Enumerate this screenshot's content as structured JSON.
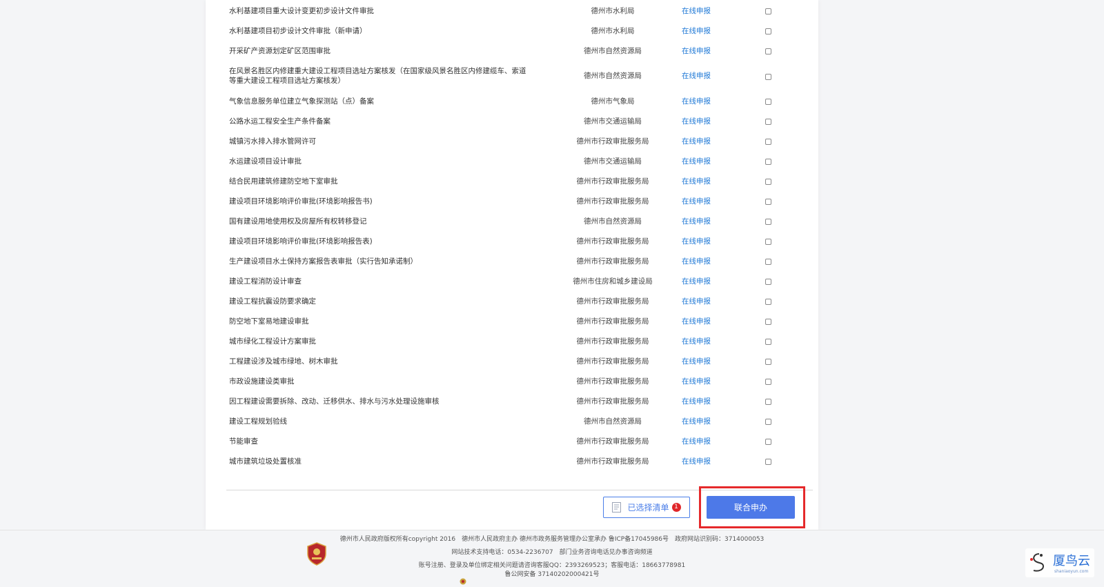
{
  "items": [
    {
      "name": "水利基建项目重大设计变更初步设计文件审批",
      "dept": "德州市水利局",
      "action": "在线申报"
    },
    {
      "name": "水利基建项目初步设计文件审批（新申请）",
      "dept": "德州市水利局",
      "action": "在线申报"
    },
    {
      "name": "开采矿产资源划定矿区范围审批",
      "dept": "德州市自然资源局",
      "action": "在线申报"
    },
    {
      "name": "在风景名胜区内修建重大建设工程项目选址方案核发（在国家级风景名胜区内修建缆车、索道等重大建设工程项目选址方案核发）",
      "dept": "德州市自然资源局",
      "action": "在线申报"
    },
    {
      "name": "气象信息服务单位建立气象探测站（点）备案",
      "dept": "德州市气象局",
      "action": "在线申报"
    },
    {
      "name": "公路水运工程安全生产条件备案",
      "dept": "德州市交通运输局",
      "action": "在线申报"
    },
    {
      "name": "城镇污水排入排水管网许可",
      "dept": "德州市行政审批服务局",
      "action": "在线申报"
    },
    {
      "name": "水运建设项目设计审批",
      "dept": "德州市交通运输局",
      "action": "在线申报"
    },
    {
      "name": "结合民用建筑修建防空地下室审批",
      "dept": "德州市行政审批服务局",
      "action": "在线申报"
    },
    {
      "name": "建设项目环境影响评价审批(环境影响报告书)",
      "dept": "德州市行政审批服务局",
      "action": "在线申报"
    },
    {
      "name": "国有建设用地使用权及房屋所有权转移登记",
      "dept": "德州市自然资源局",
      "action": "在线申报"
    },
    {
      "name": "建设项目环境影响评价审批(环境影响报告表)",
      "dept": "德州市行政审批服务局",
      "action": "在线申报"
    },
    {
      "name": "生产建设项目水土保持方案报告表审批（实行告知承诺制）",
      "dept": "德州市行政审批服务局",
      "action": "在线申报"
    },
    {
      "name": "建设工程消防设计审查",
      "dept": "德州市住房和城乡建设局",
      "action": "在线申报"
    },
    {
      "name": "建设工程抗震设防要求确定",
      "dept": "德州市行政审批服务局",
      "action": "在线申报"
    },
    {
      "name": "防空地下室易地建设审批",
      "dept": "德州市行政审批服务局",
      "action": "在线申报"
    },
    {
      "name": "城市绿化工程设计方案审批",
      "dept": "德州市行政审批服务局",
      "action": "在线申报"
    },
    {
      "name": "工程建设涉及城市绿地、树木审批",
      "dept": "德州市行政审批服务局",
      "action": "在线申报"
    },
    {
      "name": "市政设施建设类审批",
      "dept": "德州市行政审批服务局",
      "action": "在线申报"
    },
    {
      "name": "因工程建设需要拆除、改动、迁移供水、排水与污水处理设施审核",
      "dept": "德州市行政审批服务局",
      "action": "在线申报"
    },
    {
      "name": "建设工程规划验线",
      "dept": "德州市自然资源局",
      "action": "在线申报"
    },
    {
      "name": "节能审查",
      "dept": "德州市行政审批服务局",
      "action": "在线申报"
    },
    {
      "name": "城市建筑垃圾处置核准",
      "dept": "德州市行政审批服务局",
      "action": "在线申报"
    }
  ],
  "actions": {
    "selected_list_label": "已选择清单",
    "selected_count": "1",
    "joint_apply_label": "联合申办"
  },
  "footer": {
    "line1": "德州市人民政府版权所有copyright 2016　德州市人民政府主办 德州市政务服务管理办公室承办 鲁ICP备17045986号　政府网站识别码：3714000053",
    "line2": "网站技术支持电话：0534-2236707　部门业务咨询电话见办事咨询频道",
    "line3": "账号注册、登录及单位绑定相关问题请咨询客服QQ：2393269523；客服电话：18663778981",
    "line4": "鲁公网安备 37140202000421号"
  },
  "watermark": {
    "title": "厦鸟云",
    "subtitle": "shaniaoyun.com"
  },
  "colors": {
    "link": "#1e78d6",
    "primary": "#4d79e8",
    "highlight": "#e5292b",
    "badge": "#e0262a"
  }
}
